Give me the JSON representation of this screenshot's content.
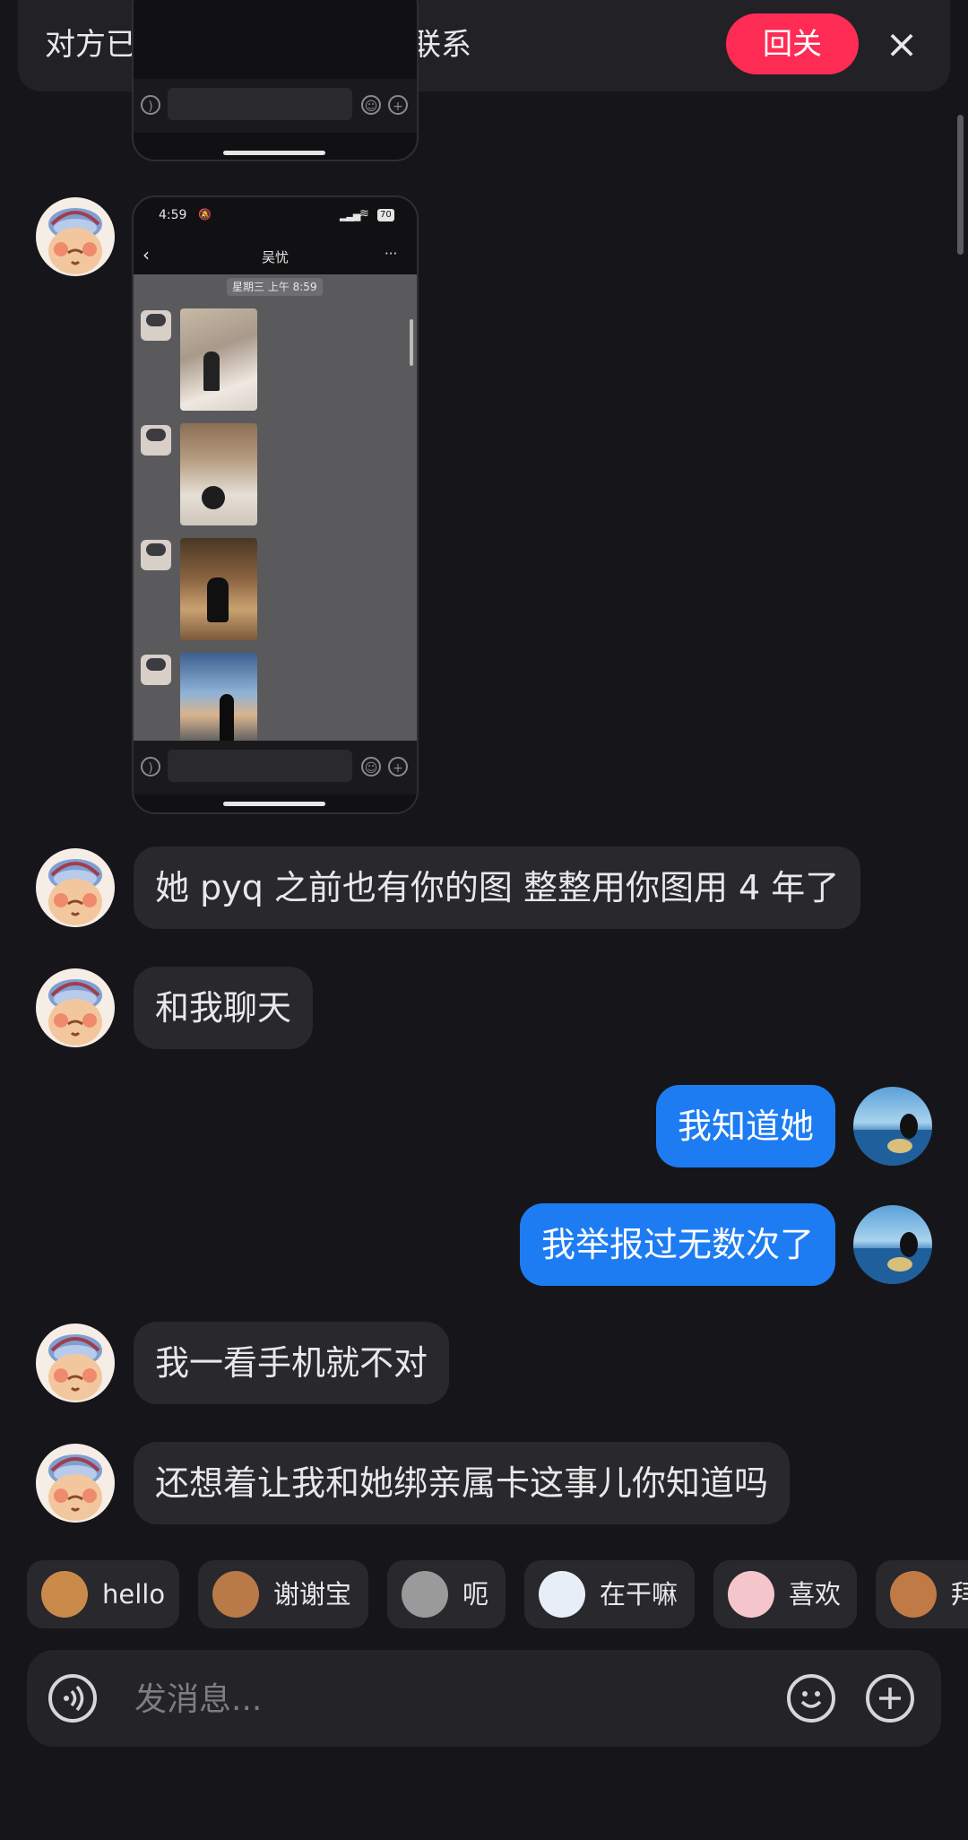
{
  "banner": {
    "text": "对方已关注你，回关方便常联系",
    "follow_label": "回关",
    "close_icon": "×"
  },
  "screenshot_top": {},
  "screenshot": {
    "status_time": "4:59",
    "status_battery": "70",
    "nav_title": "吴忧",
    "nav_more": "···",
    "timestamp": "星期三 上午 8:59"
  },
  "messages": [
    {
      "side": "left",
      "text": "她 pyq 之前也有你的图 整整用你图用 4 年了"
    },
    {
      "side": "left",
      "text": "和我聊天"
    },
    {
      "side": "right",
      "text": "我知道她"
    },
    {
      "side": "right",
      "text": "我举报过无数次了"
    },
    {
      "side": "left",
      "text": "我一看手机就不对"
    },
    {
      "side": "left",
      "text": "还想着让我和她绑亲属卡这事儿你知道吗"
    }
  ],
  "quick_stickers": [
    {
      "label": "hello",
      "icon": "monkey-wave-icon"
    },
    {
      "label": "谢谢宝",
      "icon": "monkey-flower-icon"
    },
    {
      "label": "呃",
      "icon": "cat-icon"
    },
    {
      "label": "在干嘛",
      "icon": "bubble-face-icon"
    },
    {
      "label": "喜欢",
      "icon": "pig-icon"
    },
    {
      "label": "拜",
      "icon": "monkey-cover-icon"
    }
  ],
  "input": {
    "placeholder": "发消息..."
  },
  "colors": {
    "background": "#16161a",
    "accent": "#fe2c55",
    "bubble_self": "#1e7cf2",
    "bubble_other": "#28282d"
  }
}
